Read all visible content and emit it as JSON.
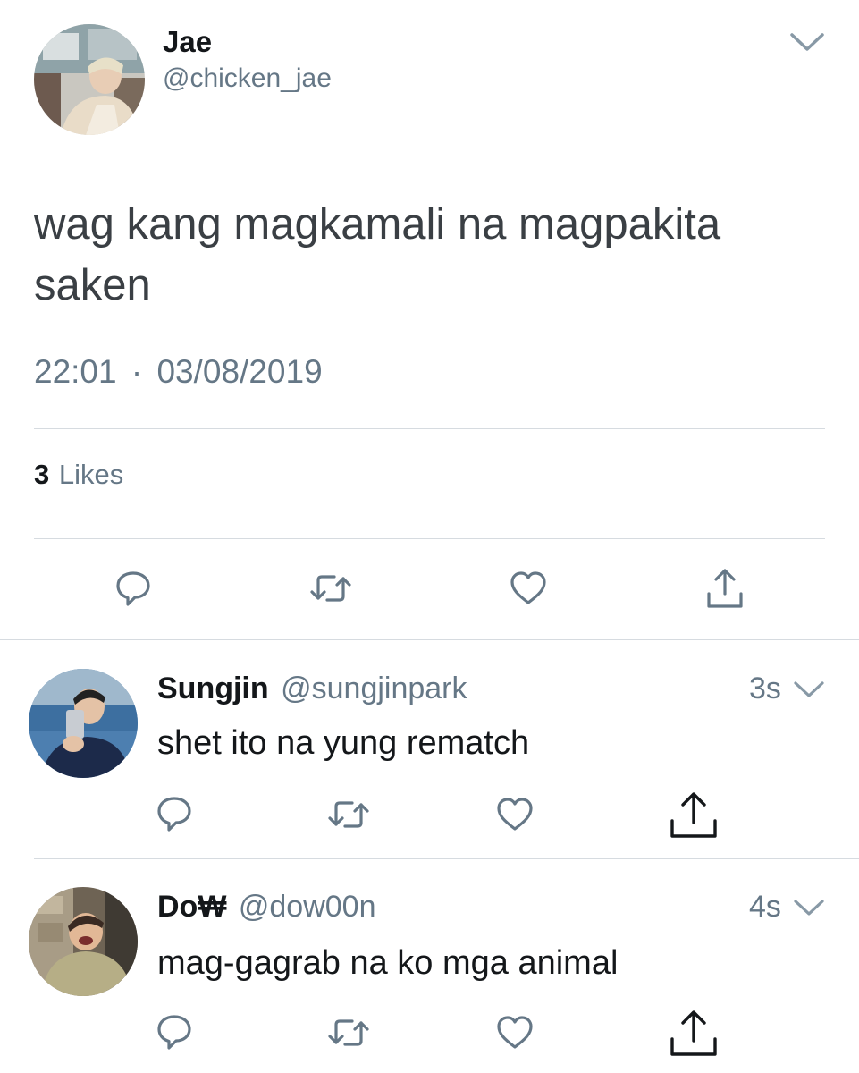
{
  "main_tweet": {
    "author_name": "Jae",
    "author_handle": "@chicken_jae",
    "text": "wag kang magkamali na magpakita saken",
    "time": "22:01",
    "separator": "·",
    "date": "03/08/2019",
    "likes_count": "3",
    "likes_label": "Likes"
  },
  "replies": [
    {
      "author_name": "Sungjin",
      "author_handle": "@sungjinpark",
      "time_ago": "3s",
      "text": "shet ito na yung rematch"
    },
    {
      "author_name": "Do₩",
      "author_handle": "@dow00n",
      "time_ago": "4s",
      "text": "mag-gagrab na ko mga animal"
    }
  ],
  "icons": {
    "reply": "reply-bubble-icon",
    "retweet": "retweet-arrows-icon",
    "like": "heart-icon",
    "share": "share-upload-icon",
    "menu": "chevron-down-icon"
  },
  "colors": {
    "text": "#14171a",
    "secondary": "#657786",
    "divider": "#d6dbe0",
    "icon": "#657786"
  }
}
